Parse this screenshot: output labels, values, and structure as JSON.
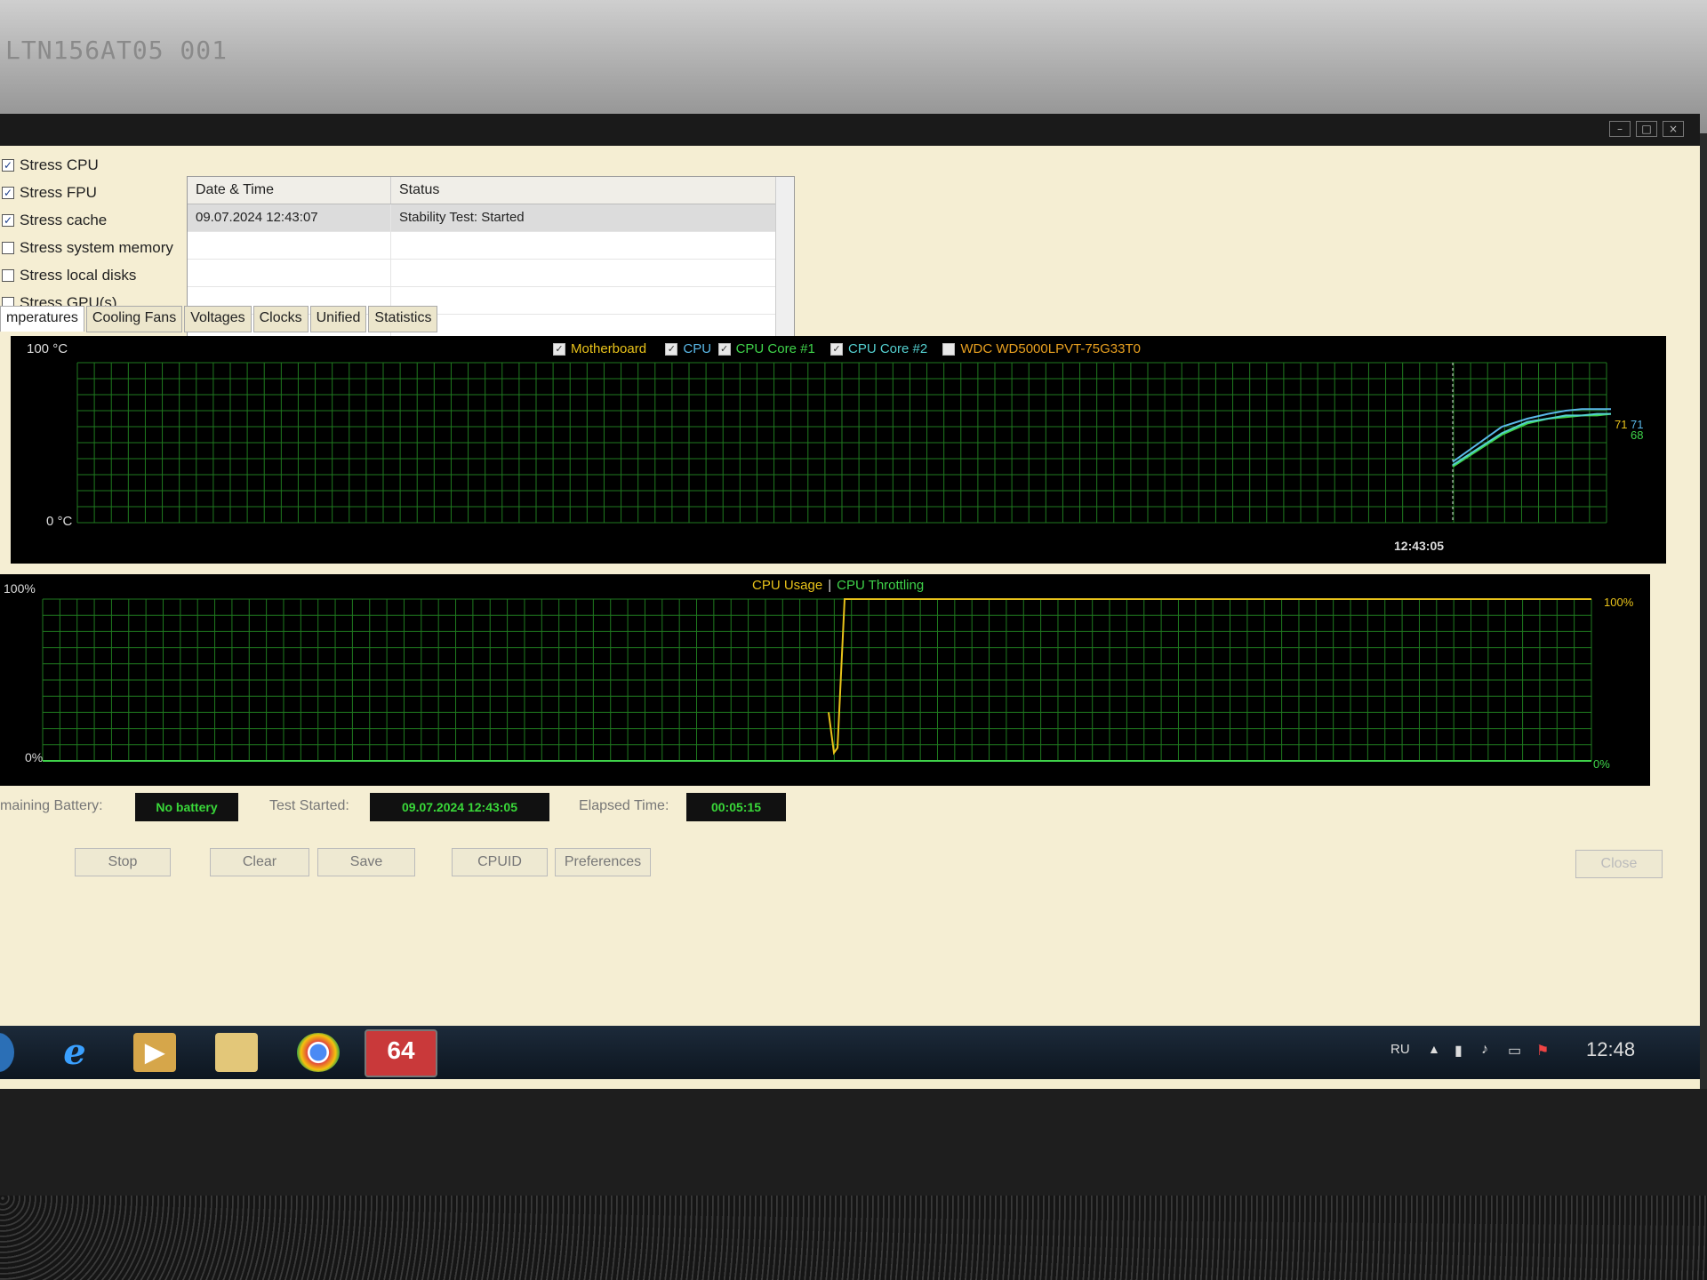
{
  "bezel": {
    "label": "LTN156AT05 001"
  },
  "stress_options": [
    {
      "label": "Stress CPU",
      "checked": true
    },
    {
      "label": "Stress FPU",
      "checked": true
    },
    {
      "label": "Stress cache",
      "checked": true
    },
    {
      "label": "Stress system memory",
      "checked": false
    },
    {
      "label": "Stress local disks",
      "checked": false
    },
    {
      "label": "Stress GPU(s)",
      "checked": false
    }
  ],
  "log": {
    "columns": [
      "Date & Time",
      "Status"
    ],
    "rows": [
      {
        "datetime": "09.07.2024 12:43:07",
        "status": "Stability Test: Started"
      }
    ]
  },
  "tabs": [
    "mperatures",
    "Cooling Fans",
    "Voltages",
    "Clocks",
    "Unified",
    "Statistics"
  ],
  "temp_graph": {
    "y_max_label": "100 °C",
    "y_min_label": "0 °C",
    "legend": [
      {
        "label": "Motherboard",
        "checked": true,
        "color": "#e8c21a"
      },
      {
        "label": "CPU",
        "checked": true,
        "color": "#5ab8e8"
      },
      {
        "label": "CPU Core #1",
        "checked": true,
        "color": "#3fd34a"
      },
      {
        "label": "CPU Core #2",
        "checked": true,
        "color": "#54d0d0"
      },
      {
        "label": "WDC WD5000LPVT-75G33T0",
        "checked": false,
        "color": "#e8a020"
      }
    ],
    "time_label": "12:43:05",
    "end_labels": {
      "a": "71",
      "b": "71",
      "c": "68"
    }
  },
  "usage_graph": {
    "y_max_label": "100%",
    "y_min_label": "0%",
    "legend_usage": "CPU Usage",
    "legend_sep": "|",
    "legend_throttle": "CPU Throttling",
    "right_max": "100%",
    "right_min": "0%"
  },
  "chart_data": [
    {
      "type": "line",
      "title": "",
      "ylim": [
        0,
        100
      ],
      "y_unit": "°C",
      "series": [
        {
          "name": "CPU",
          "values": [
            38,
            60,
            65,
            68,
            70,
            71,
            71,
            71
          ]
        },
        {
          "name": "CPU Core #1",
          "values": [
            35,
            55,
            62,
            65,
            66,
            67,
            67,
            68
          ]
        },
        {
          "name": "CPU Core #2",
          "values": [
            36,
            56,
            63,
            65,
            67,
            67,
            68,
            68
          ]
        }
      ]
    },
    {
      "type": "line",
      "ylim": [
        0,
        100
      ],
      "y_unit": "%",
      "series": [
        {
          "name": "CPU Usage",
          "values": [
            30,
            5,
            8,
            100,
            100,
            100,
            100,
            100
          ]
        }
      ]
    }
  ],
  "info": {
    "battery_label": "maining Battery:",
    "battery_value": "No battery",
    "started_label": "Test Started:",
    "started_value": "09.07.2024 12:43:05",
    "elapsed_label": "Elapsed Time:",
    "elapsed_value": "00:05:15"
  },
  "buttons": {
    "stop": "Stop",
    "clear": "Clear",
    "save": "Save",
    "cpuid": "CPUID",
    "preferences": "Preferences",
    "close": "Close"
  },
  "taskbar": {
    "aida_label": "64",
    "lang": "RU",
    "clock": "12:48"
  }
}
